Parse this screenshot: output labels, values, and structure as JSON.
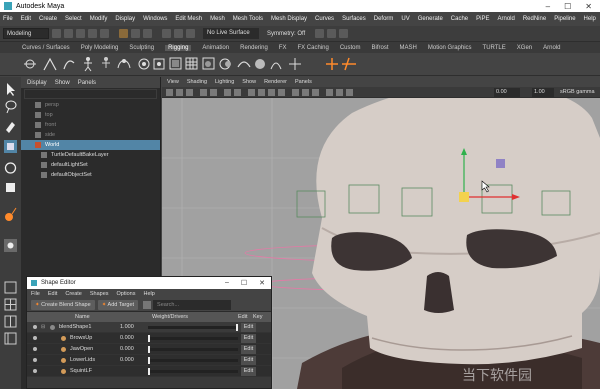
{
  "app": {
    "title": "Autodesk Maya"
  },
  "menubar": [
    "File",
    "Edit",
    "Create",
    "Select",
    "Modify",
    "Display",
    "Windows",
    "Edit Mesh",
    "Mesh",
    "Mesh Tools",
    "Mesh Display",
    "Curves",
    "Surfaces",
    "Deform",
    "UV",
    "Generate",
    "Cache",
    "PiPE",
    "Arnold",
    "RedNine",
    "Pipeline",
    "Help"
  ],
  "statusline": {
    "mode": "Modeling",
    "live_surface": "No Live Surface",
    "symmetry": "Symmetry: Off"
  },
  "shelf_tabs": [
    "Curves / Surfaces",
    "Poly Modeling",
    "Sculpting",
    "Rigging",
    "Animation",
    "Rendering",
    "FX",
    "FX Caching",
    "Custom",
    "Bifrost",
    "MASH",
    "Motion Graphics",
    "TURTLE",
    "XGen",
    "Arnold"
  ],
  "shelf_active": "Rigging",
  "outliner": {
    "menu": [
      "Display",
      "Show",
      "Panels"
    ],
    "items": [
      {
        "label": "persp",
        "state": "dim"
      },
      {
        "label": "top",
        "state": "dim"
      },
      {
        "label": "front",
        "state": "dim"
      },
      {
        "label": "side",
        "state": "dim"
      },
      {
        "label": "World",
        "state": "selected"
      },
      {
        "label": "TurtleDefaultBakeLayer",
        "state": "lit"
      },
      {
        "label": "defaultLightSet",
        "state": "lit"
      },
      {
        "label": "defaultObjectSet",
        "state": "lit"
      }
    ]
  },
  "viewport": {
    "menu": [
      "View",
      "Shading",
      "Lighting",
      "Show",
      "Renderer",
      "Panels"
    ],
    "near_value": "0.00",
    "far_value": "1.00",
    "color_space": "sRGB gamma"
  },
  "shape_editor": {
    "title": "Shape Editor",
    "menu": [
      "File",
      "Edit",
      "Create",
      "Shapes",
      "Options",
      "Help"
    ],
    "create_button": "Create Blend Shape",
    "add_target_button": "Add Target",
    "search_placeholder": "Search...",
    "columns": {
      "name": "Name",
      "weight": "Weight/Drivers",
      "edit": "Edit",
      "key": "Key"
    },
    "rows": [
      {
        "name": "blendShape1",
        "value": "1.000",
        "type": "parent"
      },
      {
        "name": "BrowsUp",
        "value": "0.000",
        "type": "target"
      },
      {
        "name": "JawOpen",
        "value": "0.000",
        "type": "target"
      },
      {
        "name": "LowerLids",
        "value": "0.000",
        "type": "target"
      },
      {
        "name": "SquintLF",
        "value": "",
        "type": "target"
      }
    ],
    "edit_label": "Edit"
  },
  "watermark": "当下软件园",
  "colors": {
    "selection": "#5285a6",
    "bg": "#444444",
    "viewport": "#a1a1a1",
    "target_swatch": "#d39b59"
  }
}
